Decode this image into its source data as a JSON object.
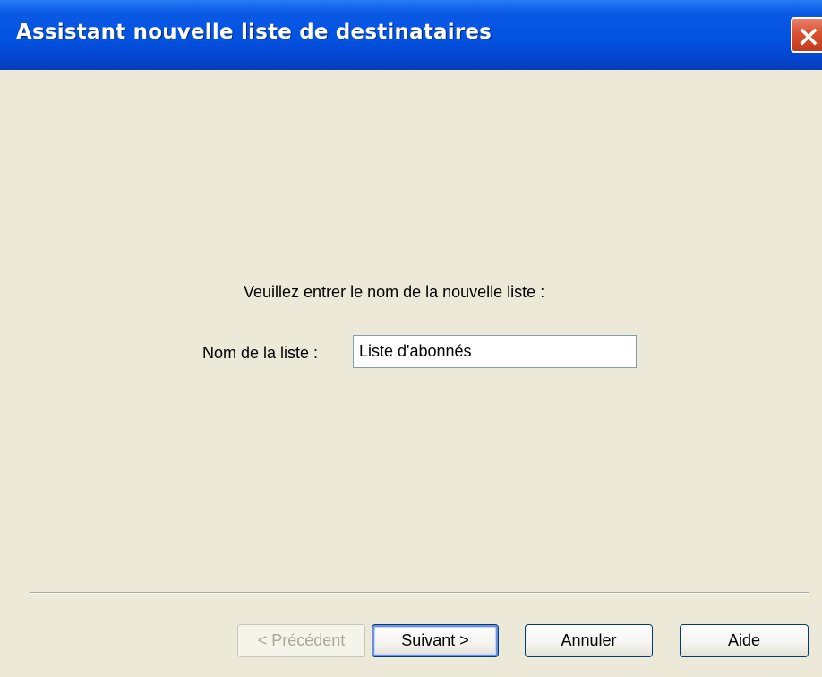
{
  "window": {
    "title": "Assistant nouvelle liste de destinataires",
    "close_icon": "close-x-icon"
  },
  "form": {
    "prompt": "Veuillez entrer le nom de la nouvelle liste :",
    "list_name_label": "Nom de la liste :",
    "list_name_value": "Liste d'abonnés"
  },
  "buttons": {
    "previous": "< Précédent",
    "next": "Suivant >",
    "cancel": "Annuler",
    "help": "Aide"
  },
  "colors": {
    "titlebar": "#0252E0",
    "dialog_background": "#ECE9D8",
    "close_button": "#D9512F"
  }
}
